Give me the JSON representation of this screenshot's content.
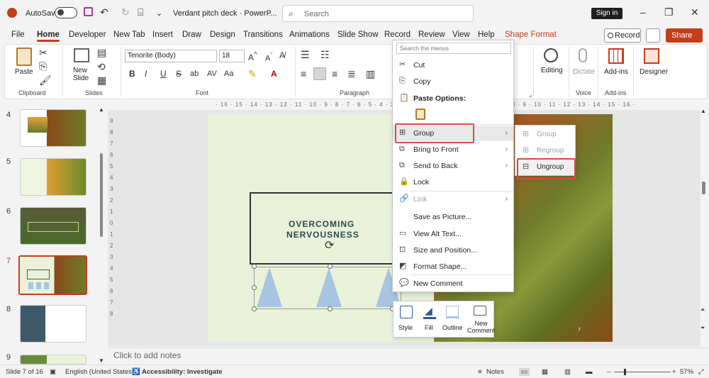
{
  "app": {
    "autosave_label": "AutoSave",
    "doc_title": "Verdant pitch deck · PowerP...",
    "search_placeholder": "Search",
    "signin": "Sign in"
  },
  "tabs": [
    "File",
    "Home",
    "Developer",
    "New Tab",
    "Insert",
    "Draw",
    "Design",
    "Transitions",
    "Animations",
    "Slide Show",
    "Record",
    "Review",
    "View",
    "Help",
    "Shape Format"
  ],
  "topright": {
    "record": "Record",
    "share": "Share"
  },
  "ribbon": {
    "paste": "Paste",
    "new_slide": "New\nSlide",
    "font_name": "Tenorite (Body)",
    "font_size": "18",
    "groups": {
      "clipboard": "Clipboard",
      "slides": "Slides",
      "font": "Font",
      "paragraph": "Paragraph",
      "voice": "Voice",
      "addins": "Add-ins"
    },
    "editing": "Editing",
    "dictate": "Dictate",
    "addins_btn": "Add-ins",
    "designer": "Designer",
    "format_buttons": [
      "B",
      "I",
      "U",
      "S",
      "ab",
      "AV",
      "Aa"
    ]
  },
  "slides": [
    {
      "num": "4"
    },
    {
      "num": "5"
    },
    {
      "num": "6"
    },
    {
      "num": "7"
    },
    {
      "num": "8"
    },
    {
      "num": "9"
    }
  ],
  "ruler_h": "· 16 · 15 · 14 · 13 · 12 · 11 · 10 · 9 · 8 · 7 · 6 · 5 · 4 · 3 · 2 · 1 · 0 · 1 · 2 · 3 · 4 · 5 · 6 · 7 · 8 · 9 · 10 · 11 · 12 · 13 · 14 · 15 · 16 ·",
  "ruler_v": [
    "9",
    "8",
    "7",
    "6",
    "5",
    "4",
    "3",
    "2",
    "1",
    "0",
    "1",
    "2",
    "3",
    "4",
    "5",
    "6",
    "7",
    "8"
  ],
  "slide": {
    "title_line1": "OVERCOMING",
    "title_line2": "NERVOUSNESS",
    "page_num": "7"
  },
  "context_menu": {
    "search_placeholder": "Search the menus",
    "items": [
      {
        "label": "Cut",
        "icon": "✂"
      },
      {
        "label": "Copy",
        "icon": "⎘"
      },
      {
        "label": "Paste Options:",
        "icon": "📋"
      },
      {
        "label": "Group",
        "icon": "⊞"
      },
      {
        "label": "Bring to Front",
        "icon": "⧉"
      },
      {
        "label": "Send to Back",
        "icon": "⧉"
      },
      {
        "label": "Lock",
        "icon": "🔒"
      },
      {
        "label": "Link",
        "icon": "🔗"
      },
      {
        "label": "Save as Picture...",
        "icon": ""
      },
      {
        "label": "View Alt Text...",
        "icon": "▭"
      },
      {
        "label": "Size and Position...",
        "icon": "⊡"
      },
      {
        "label": "Format Shape...",
        "icon": "◩"
      },
      {
        "label": "New Comment",
        "icon": "💬"
      }
    ]
  },
  "submenu": {
    "items": [
      "Group",
      "Regroup",
      "Ungroup"
    ]
  },
  "mini_toolbar": {
    "style": "Style",
    "fill": "Fill",
    "outline": "Outline",
    "new_comment": "New\nComment"
  },
  "notes": "Click to add notes",
  "status": {
    "slide_info": "Slide 7 of 16",
    "language": "English (United States)",
    "accessibility": "Accessibility: Investigate",
    "notes": "Notes",
    "zoom": "57%"
  },
  "colors": {
    "accent": "#c43e1c",
    "highlight": "#e0454d",
    "triangle": "#a8c4e0",
    "slide_bg": "#e9f2d9"
  }
}
